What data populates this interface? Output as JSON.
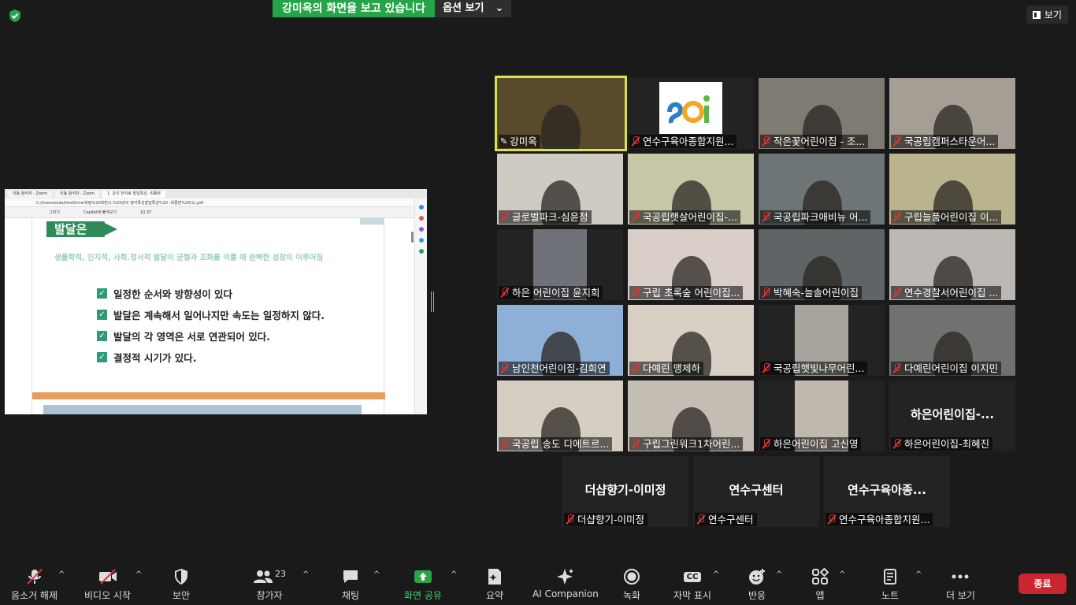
{
  "banner": {
    "viewing": "강미옥의 화면을 보고 있습니다",
    "options": "옵션 보기",
    "options_caret": "⌄"
  },
  "view_button": {
    "label": "보기"
  },
  "shared_screen": {
    "tabs": [
      "이동 참석자 - Zoom",
      "이동 참석자 - Zoom",
      "1. 강의 한자료 발달특성 -최종본"
    ],
    "address": "C:/Users/soda/OneDrive/바탕%20화면/1.%20강의 영아특성발달특성%20 -최종본%20(1).pdf",
    "tools": [
      "그리기",
      "Copilot에 물어보기",
      "10.37"
    ],
    "document": {
      "heading": "발달은",
      "subtitle": "생물학적, 인지적, 사회.정서적 발달이 균형과 조화를 이룰 때 완벽한 성장이 이루어짐",
      "items": [
        "일정한 순서와 방향성이  있다",
        "발달은 계속해서 일어나지만 속도는 일정하지 않다.",
        "발달의 각 영역은 서로 연관되어 있다.",
        "결정적 시기가 있다."
      ],
      "check_glyph": "✓"
    }
  },
  "tiles": [
    {
      "name": "강미옥",
      "muted": false,
      "active": true,
      "bg": "#5a4a2c"
    },
    {
      "name": "연수구육아종합지원...",
      "muted": true,
      "bg": "#232323",
      "logo": true
    },
    {
      "name": "작은꽃어린이집 - 조...",
      "muted": true,
      "bg": "#7f7a72"
    },
    {
      "name": "국공립캠퍼스타운어...",
      "muted": true,
      "bg": "#a59e94"
    },
    {
      "name": "글로벌파크-심윤정",
      "muted": true,
      "bg": "#cfcac2"
    },
    {
      "name": "국공립햇살어린이집-...",
      "muted": true,
      "bg": "#c6c7a6"
    },
    {
      "name": "국공립파크애비뉴 어...",
      "muted": true,
      "bg": "#6e7576"
    },
    {
      "name": "구립늘품어린이집 이...",
      "muted": true,
      "bg": "#b9b48e"
    },
    {
      "name": "하은 어린이집 윤지희",
      "muted": true,
      "bg": "#232323",
      "inset": "#6f7278"
    },
    {
      "name": "구립 초록숲 어린이집...",
      "muted": true,
      "bg": "#d9cfc8"
    },
    {
      "name": "박혜숙-늘솔어린이집",
      "muted": true,
      "bg": "#5f6466"
    },
    {
      "name": "연수경찰서어린이집 ...",
      "muted": true,
      "bg": "#bdb8b3"
    },
    {
      "name": "남인천어린이집-김희연",
      "muted": true,
      "bg": "#8fb0d6"
    },
    {
      "name": "다예린 맹제하",
      "muted": true,
      "bg": "#d8d0c4"
    },
    {
      "name": "국공립햇빛나무어린...",
      "muted": true,
      "bg": "#232323",
      "inset": "#a7a59c"
    },
    {
      "name": "다예린어린이집 이지민",
      "muted": true,
      "bg": "#6f726f"
    },
    {
      "name": "국공립 송도 디에트르...",
      "muted": true,
      "bg": "#d7cec3"
    },
    {
      "name": "구립그린워크1차어린...",
      "muted": true,
      "bg": "#c4bdb4"
    },
    {
      "name": "하은어린이집 고신영",
      "muted": true,
      "bg": "#232323",
      "inset": "#c0b8ae"
    },
    {
      "name": "하은어린이집-최혜진",
      "muted": true,
      "bg": "#232323",
      "big": "하은어린이집-..."
    },
    {
      "name": "더샵향기-이미정",
      "muted": true,
      "bg": "#232323",
      "big": "더샵향기-이미정"
    },
    {
      "name": "연수구센터",
      "muted": true,
      "bg": "#232323",
      "big": "연수구센터"
    },
    {
      "name": "연수구육아종합지원...",
      "muted": true,
      "bg": "#232323",
      "big": "연수구육아종..."
    }
  ],
  "toolbar": {
    "mute": "음소거 해제",
    "video": "비디오 시작",
    "security": "보안",
    "participants": "참가자",
    "participant_count": "23",
    "chat": "채팅",
    "share": "화면 공유",
    "summary": "요약",
    "ai": "AI Companion",
    "record": "녹화",
    "captions": "자막 표시",
    "captions_badge": "CC",
    "reactions": "반응",
    "apps": "앱",
    "notes": "노트",
    "more": "더 보기",
    "end": "종료",
    "caret": "^"
  },
  "colors": {
    "share_green": "#25a547",
    "end_red": "#c9262f",
    "active_border": "#d9e34a",
    "mute_red": "#e03434"
  }
}
